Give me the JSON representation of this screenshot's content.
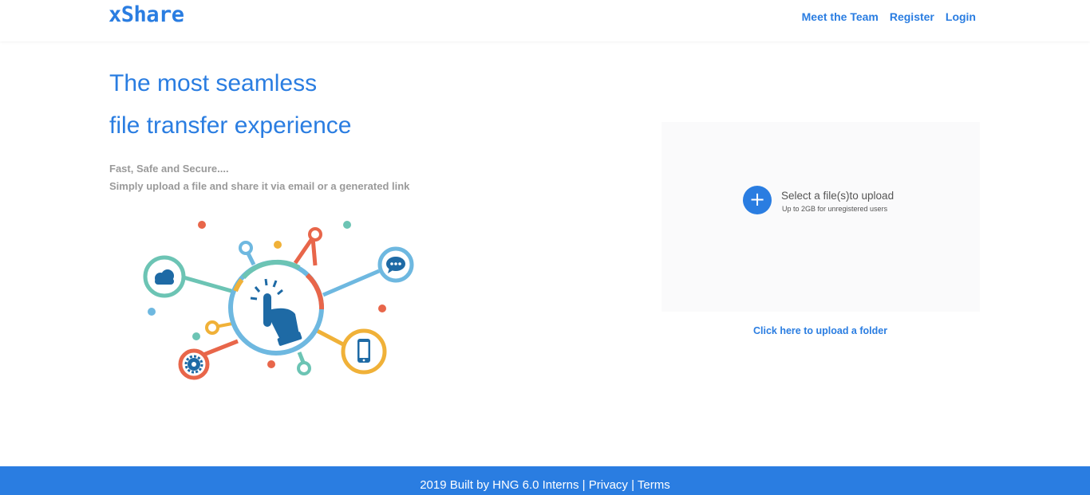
{
  "brand": {
    "logo": "xShare"
  },
  "nav": {
    "items": [
      {
        "label": "Meet the Team"
      },
      {
        "label": "Register"
      },
      {
        "label": "Login"
      }
    ]
  },
  "hero": {
    "title_line1": "The most seamless",
    "title_line2": "file transfer experience",
    "subtitle1": "Fast, Safe and Secure....",
    "subtitle2": "Simply upload a file and share it via email or a generated link"
  },
  "upload": {
    "plus_icon": "+",
    "title": "Select a file(s)to upload",
    "subtitle": "Up to 2GB for unregistered users",
    "folder_link": "Click here to upload a folder"
  },
  "footer": {
    "built_text": "2019 Built by HNG 6.0 Interns",
    "separator": "|",
    "privacy": "Privacy",
    "terms": "Terms"
  },
  "colors": {
    "brand_blue": "#2a7de1",
    "teal": "#6cc4b4",
    "orange_red": "#e8664a",
    "yellow": "#f0b138",
    "light_blue": "#6eb8e0",
    "dark_blue": "#1e6aa5"
  },
  "icons": {
    "illustration": [
      "cloud-icon",
      "chat-icon",
      "phone-icon",
      "gear-icon",
      "touch-hand-icon"
    ]
  }
}
